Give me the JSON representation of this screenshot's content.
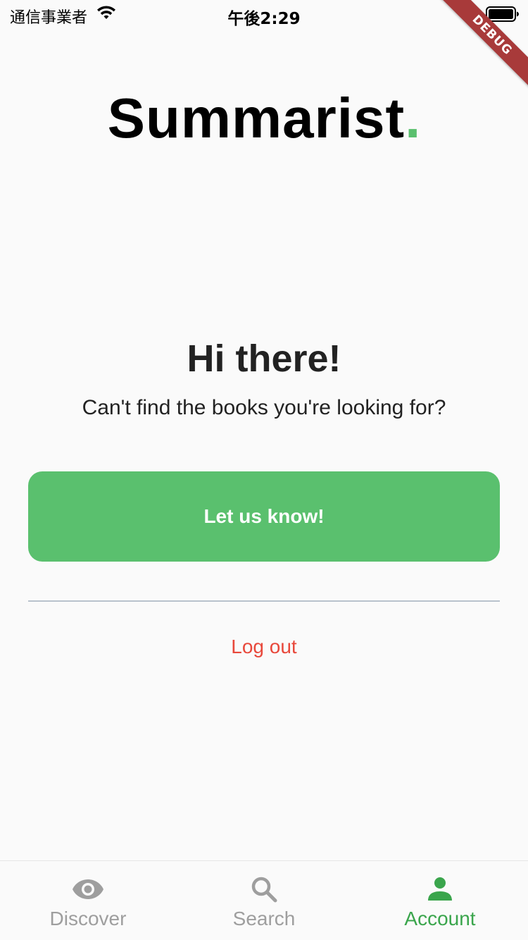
{
  "status_bar": {
    "carrier": "通信事業者",
    "time": "午後2:29"
  },
  "debug_banner": "DEBUG",
  "logo": {
    "text": "Summarist",
    "dot": "."
  },
  "greeting": "Hi there!",
  "subtitle": "Can't find the books you're looking for?",
  "cta_label": "Let us know!",
  "logout_label": "Log out",
  "nav": {
    "items": [
      {
        "label": "Discover",
        "icon": "eye-icon",
        "active": false
      },
      {
        "label": "Search",
        "icon": "search-icon",
        "active": false
      },
      {
        "label": "Account",
        "icon": "person-icon",
        "active": true
      }
    ]
  },
  "colors": {
    "accent": "#5ac06e",
    "logout": "#e8483b",
    "nav_inactive": "#9e9e9e",
    "nav_active": "#3aa54c"
  }
}
